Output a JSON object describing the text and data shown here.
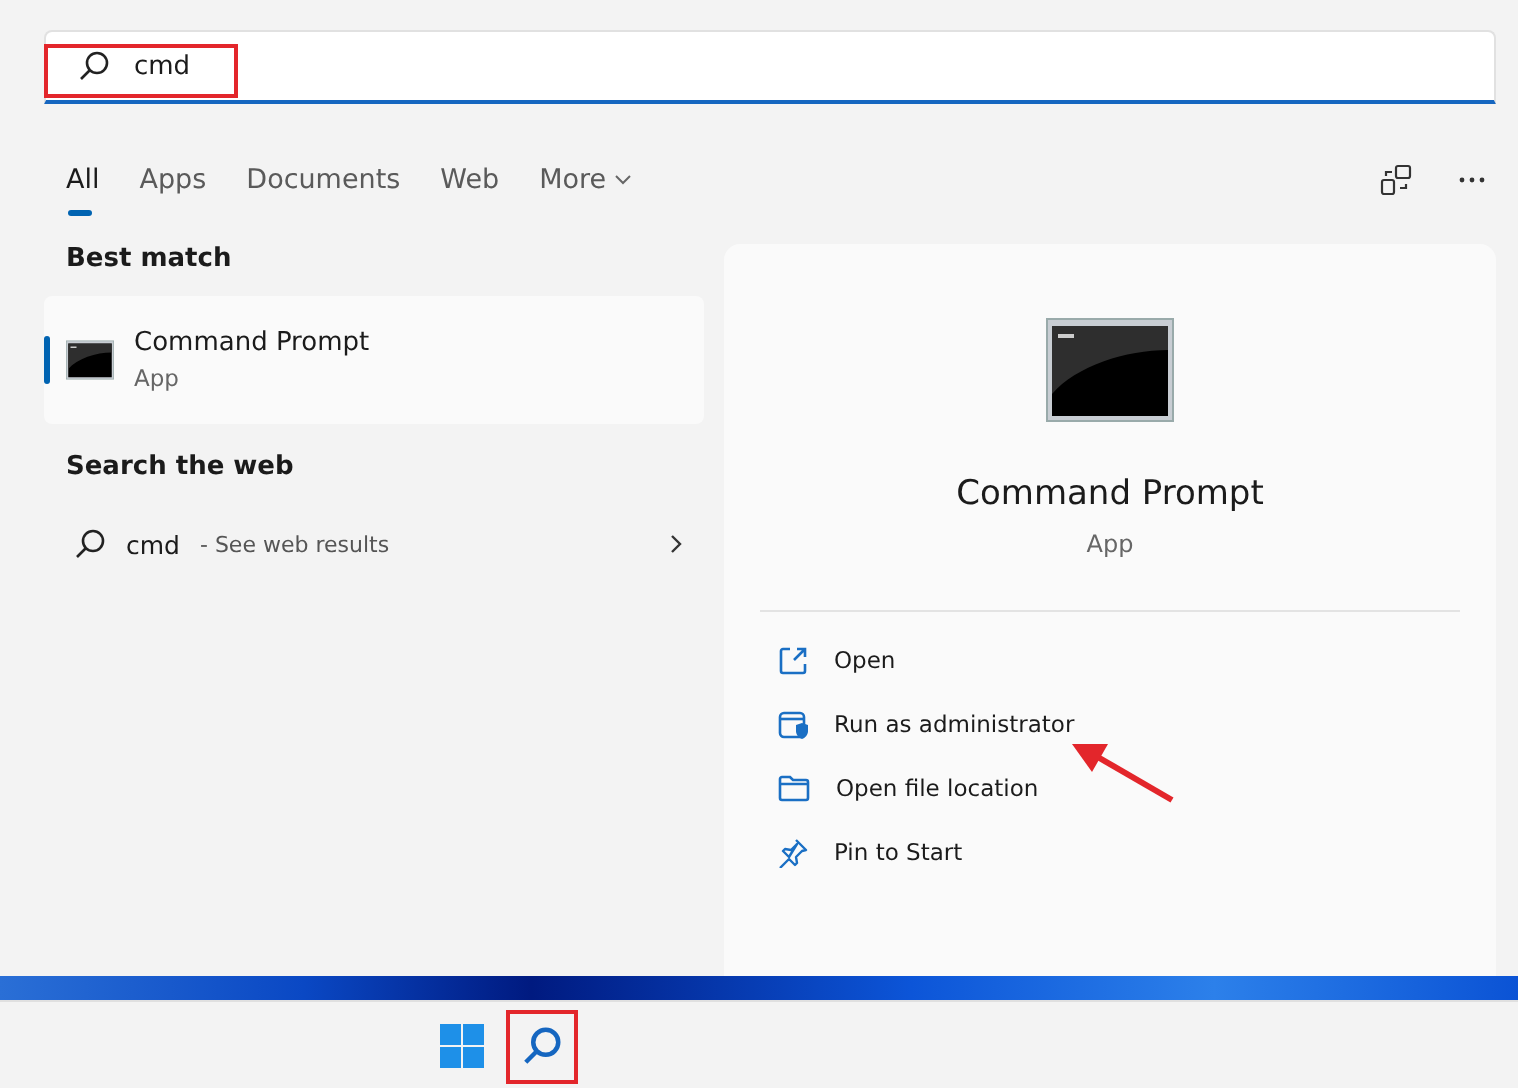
{
  "search": {
    "value": "cmd"
  },
  "tabs": [
    {
      "label": "All",
      "selected": true,
      "kind": "tab"
    },
    {
      "label": "Apps",
      "selected": false,
      "kind": "tab"
    },
    {
      "label": "Documents",
      "selected": false,
      "kind": "tab"
    },
    {
      "label": "Web",
      "selected": false,
      "kind": "tab"
    },
    {
      "label": "More",
      "selected": false,
      "kind": "dropdown"
    }
  ],
  "best_match": {
    "heading": "Best match",
    "item": {
      "title": "Command Prompt",
      "subtitle": "App",
      "selected": true
    }
  },
  "web": {
    "heading": "Search the web",
    "item": {
      "query": "cmd",
      "hint": "- See web results"
    }
  },
  "details": {
    "title": "Command Prompt",
    "subtitle": "App",
    "actions": [
      {
        "label": "Open",
        "kind": "open"
      },
      {
        "label": "Run as administrator",
        "kind": "admin"
      },
      {
        "label": "Open file location",
        "kind": "folder"
      },
      {
        "label": "Pin to Start",
        "kind": "pin"
      }
    ]
  }
}
